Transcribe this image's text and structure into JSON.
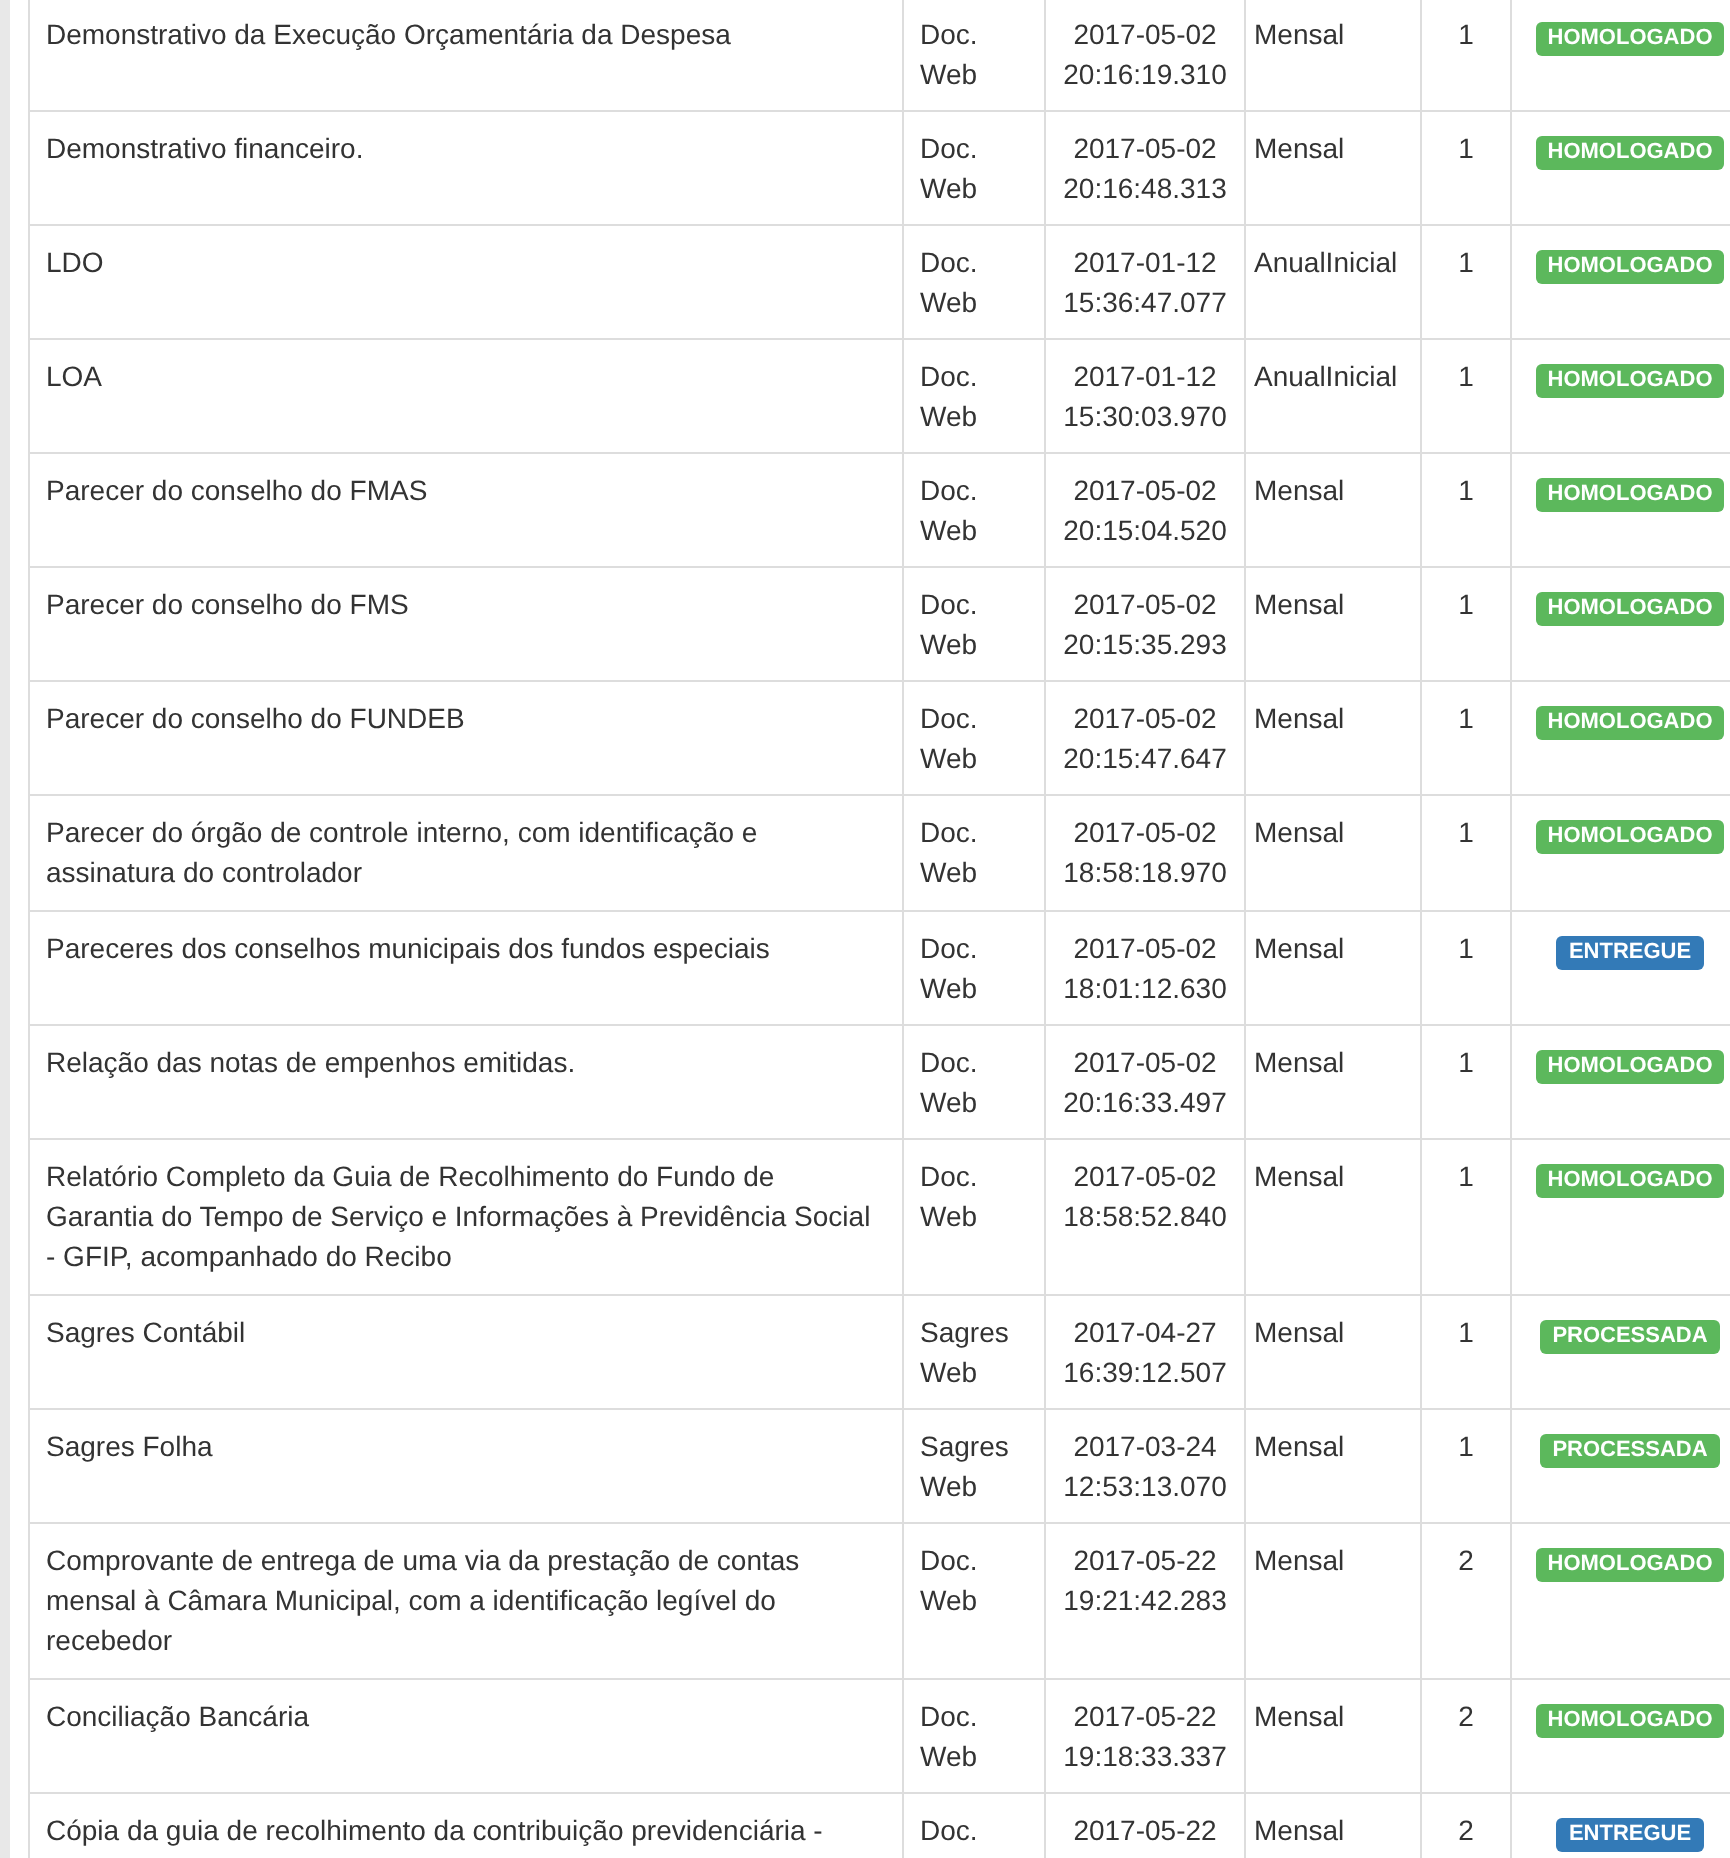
{
  "rows": [
    {
      "document": "Demonstrativo da Execução Orçamentária da Despesa",
      "type": "Doc. Web",
      "date": "2017-05-02 20:16:19.310",
      "frequency": "Mensal",
      "number": "1",
      "status": {
        "label": "HOMOLOGADO",
        "color": "#5cb85c"
      }
    },
    {
      "document": "Demonstrativo financeiro.",
      "type": "Doc. Web",
      "date": "2017-05-02 20:16:48.313",
      "frequency": "Mensal",
      "number": "1",
      "status": {
        "label": "HOMOLOGADO",
        "color": "#5cb85c"
      }
    },
    {
      "document": "LDO",
      "type": "Doc. Web",
      "date": "2017-01-12 15:36:47.077",
      "frequency": "AnualInicial",
      "number": "1",
      "status": {
        "label": "HOMOLOGADO",
        "color": "#5cb85c"
      }
    },
    {
      "document": "LOA",
      "type": "Doc. Web",
      "date": "2017-01-12 15:30:03.970",
      "frequency": "AnualInicial",
      "number": "1",
      "status": {
        "label": "HOMOLOGADO",
        "color": "#5cb85c"
      }
    },
    {
      "document": "Parecer do conselho do FMAS",
      "type": "Doc. Web",
      "date": "2017-05-02 20:15:04.520",
      "frequency": "Mensal",
      "number": "1",
      "status": {
        "label": "HOMOLOGADO",
        "color": "#5cb85c"
      }
    },
    {
      "document": "Parecer do conselho do FMS",
      "type": "Doc. Web",
      "date": "2017-05-02 20:15:35.293",
      "frequency": "Mensal",
      "number": "1",
      "status": {
        "label": "HOMOLOGADO",
        "color": "#5cb85c"
      }
    },
    {
      "document": "Parecer do conselho do FUNDEB",
      "type": "Doc. Web",
      "date": "2017-05-02 20:15:47.647",
      "frequency": "Mensal",
      "number": "1",
      "status": {
        "label": "HOMOLOGADO",
        "color": "#5cb85c"
      }
    },
    {
      "document": "Parecer do órgão de controle interno, com identificação e assinatura do controlador",
      "type": "Doc. Web",
      "date": "2017-05-02 18:58:18.970",
      "frequency": "Mensal",
      "number": "1",
      "status": {
        "label": "HOMOLOGADO",
        "color": "#5cb85c"
      }
    },
    {
      "document": "Pareceres dos conselhos municipais dos fundos especiais",
      "type": "Doc. Web",
      "date": "2017-05-02 18:01:12.630",
      "frequency": "Mensal",
      "number": "1",
      "status": {
        "label": "ENTREGUE",
        "color": "#337ab7"
      }
    },
    {
      "document": "Relação das notas de empenhos emitidas.",
      "type": "Doc. Web",
      "date": "2017-05-02 20:16:33.497",
      "frequency": "Mensal",
      "number": "1",
      "status": {
        "label": "HOMOLOGADO",
        "color": "#5cb85c"
      }
    },
    {
      "document": "Relatório Completo da Guia de Recolhimento do Fundo de Garantia do Tempo de Serviço e Informações à Previdência Social - GFIP, acompanhado do Recibo",
      "type": "Doc. Web",
      "date": "2017-05-02 18:58:52.840",
      "frequency": "Mensal",
      "number": "1",
      "status": {
        "label": "HOMOLOGADO",
        "color": "#5cb85c"
      }
    },
    {
      "document": "Sagres Contábil",
      "type": "Sagres Web",
      "date": "2017-04-27 16:39:12.507",
      "frequency": "Mensal",
      "number": "1",
      "status": {
        "label": "PROCESSADA",
        "color": "#5cb85c"
      }
    },
    {
      "document": "Sagres Folha",
      "type": "Sagres Web",
      "date": "2017-03-24 12:53:13.070",
      "frequency": "Mensal",
      "number": "1",
      "status": {
        "label": "PROCESSADA",
        "color": "#5cb85c"
      }
    },
    {
      "document": "Comprovante de entrega de uma via da prestação de contas mensal à Câmara Municipal, com a identificação legível do recebedor",
      "type": "Doc. Web",
      "date": "2017-05-22 19:21:42.283",
      "frequency": "Mensal",
      "number": "2",
      "status": {
        "label": "HOMOLOGADO",
        "color": "#5cb85c"
      }
    },
    {
      "document": "Conciliação Bancária",
      "type": "Doc. Web",
      "date": "2017-05-22 19:18:33.337",
      "frequency": "Mensal",
      "number": "2",
      "status": {
        "label": "HOMOLOGADO",
        "color": "#5cb85c"
      }
    },
    {
      "document": "Cópia da guia de recolhimento da contribuição previdenciária -",
      "type": "Doc.",
      "date": "2017-05-22",
      "frequency": "Mensal",
      "number": "2",
      "status": {
        "label": "ENTREGUE",
        "color": "#337ab7"
      }
    }
  ]
}
